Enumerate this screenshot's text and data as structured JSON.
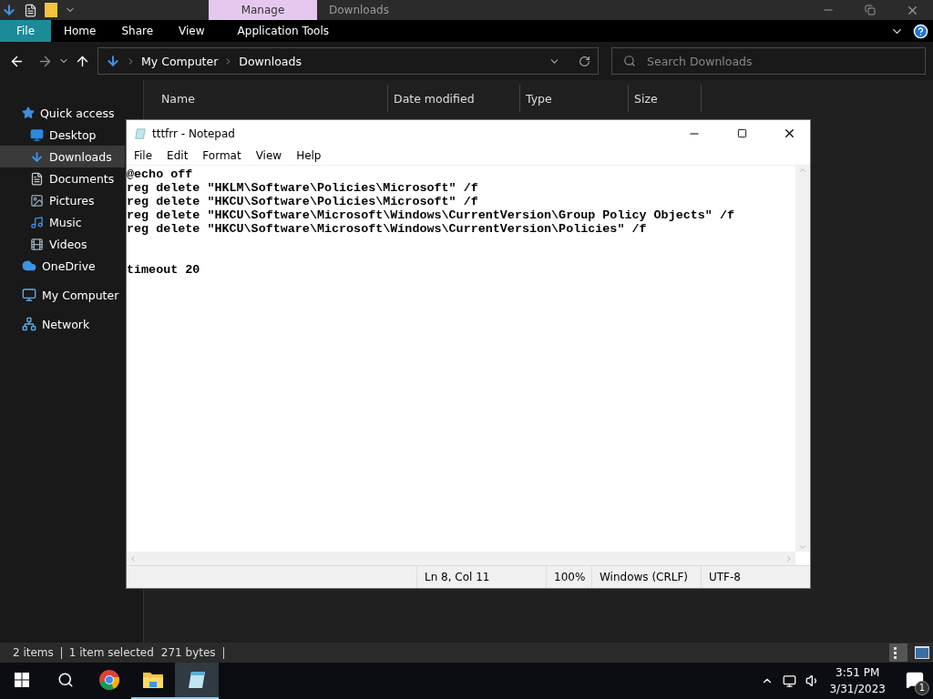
{
  "explorer": {
    "title": "Downloads",
    "context_tab": "Manage",
    "ribbon_tabs": [
      {
        "label": "File",
        "kind": "file"
      },
      {
        "label": "Home",
        "kind": "normal"
      },
      {
        "label": "Share",
        "kind": "normal"
      },
      {
        "label": "View",
        "kind": "normal"
      },
      {
        "label": "Application Tools",
        "kind": "context"
      }
    ],
    "address": {
      "path": [
        "My Computer",
        "Downloads"
      ]
    },
    "search": {
      "placeholder": "Search Downloads"
    },
    "nav": [
      {
        "label": "Quick access",
        "kind": "star",
        "selected": false,
        "children": [
          {
            "label": "Desktop",
            "kind": "desktop",
            "selected": false
          },
          {
            "label": "Downloads",
            "kind": "download",
            "selected": true
          },
          {
            "label": "Documents",
            "kind": "documents",
            "selected": false
          },
          {
            "label": "Pictures",
            "kind": "pictures",
            "selected": false
          },
          {
            "label": "Music",
            "kind": "music",
            "selected": false
          },
          {
            "label": "Videos",
            "kind": "videos",
            "selected": false
          }
        ]
      },
      {
        "label": "OneDrive",
        "kind": "cloud",
        "selected": false
      },
      {
        "label": "My Computer",
        "kind": "computer",
        "selected": false
      },
      {
        "label": "Network",
        "kind": "network",
        "selected": false
      }
    ],
    "columns": [
      "Name",
      "Date modified",
      "Type",
      "Size"
    ],
    "status": {
      "items": "2 items",
      "selection": "1 item selected",
      "size": "271 bytes"
    }
  },
  "notepad": {
    "title": "tttfrr - Notepad",
    "menu": [
      "File",
      "Edit",
      "Format",
      "View",
      "Help"
    ],
    "text": "@echo off\nreg delete \"HKLM\\Software\\Policies\\Microsoft\" /f\nreg delete \"HKCU\\Software\\Policies\\Microsoft\" /f\nreg delete \"HKCU\\Software\\Microsoft\\Windows\\CurrentVersion\\Group Policy Objects\" /f\nreg delete \"HKCU\\Software\\Microsoft\\Windows\\CurrentVersion\\Policies\" /f\n\n\ntimeout 20",
    "status": {
      "position": "Ln 8, Col 11",
      "zoom": "100%",
      "line_endings": "Windows (CRLF)",
      "encoding": "UTF-8"
    }
  },
  "taskbar": {
    "apps": [
      {
        "kind": "chrome",
        "running": false,
        "active": false
      },
      {
        "kind": "folder",
        "running": true,
        "active": false
      },
      {
        "kind": "notepad",
        "running": true,
        "active": true
      }
    ],
    "time": "3:51 PM",
    "date": "3/31/2023",
    "notifications": "1"
  }
}
